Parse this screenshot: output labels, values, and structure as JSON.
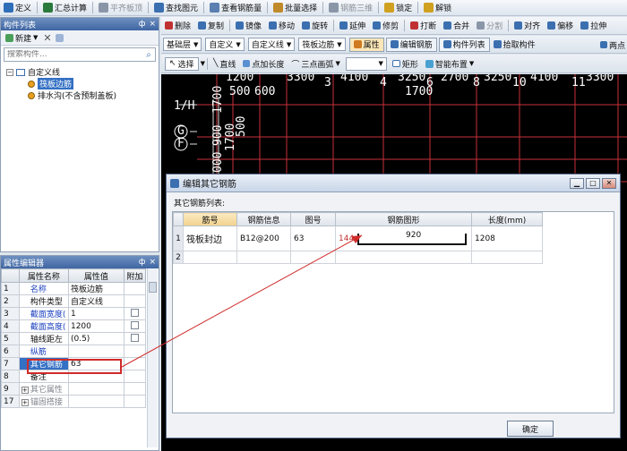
{
  "menubar": {
    "items": [
      {
        "label": "定义",
        "color": "#2f6fb8",
        "enabled": true
      },
      {
        "label": "汇总计算",
        "color": "#2b7a3d",
        "enabled": true
      },
      {
        "label": "平齐板顶",
        "color": "#8a96a8",
        "enabled": false
      },
      {
        "label": "查找图元",
        "color": "#3b6fb0",
        "enabled": true
      },
      {
        "label": "查看钢筋量",
        "color": "#5a7fb0",
        "enabled": true
      },
      {
        "label": "批量选择",
        "color": "#c08a2a",
        "enabled": true
      },
      {
        "label": "钢筋三维",
        "color": "#8a96a8",
        "enabled": false
      },
      {
        "label": "锁定",
        "color": "#d0a020",
        "enabled": true
      },
      {
        "label": "解锁",
        "color": "#d0a020",
        "enabled": true
      }
    ]
  },
  "toolbar1": {
    "items": [
      {
        "label": "删除",
        "color": "#c03030",
        "enabled": true
      },
      {
        "label": "复制",
        "color": "#3b6fb0",
        "enabled": true
      },
      {
        "label": "镜像",
        "color": "#3b6fb0",
        "enabled": true
      },
      {
        "label": "移动",
        "color": "#3b6fb0",
        "enabled": true
      },
      {
        "label": "旋转",
        "color": "#3b6fb0",
        "enabled": true
      },
      {
        "label": "延伸",
        "color": "#3b6fb0",
        "enabled": true
      },
      {
        "label": "修剪",
        "color": "#3b6fb0",
        "enabled": true
      },
      {
        "label": "打断",
        "color": "#c03030",
        "enabled": true
      },
      {
        "label": "合并",
        "color": "#3b6fb0",
        "enabled": true
      },
      {
        "label": "分割",
        "color": "#8a96a8",
        "enabled": false
      },
      {
        "label": "对齐",
        "color": "#3b6fb0",
        "enabled": true
      },
      {
        "label": "偏移",
        "color": "#3b6fb0",
        "enabled": true
      },
      {
        "label": "拉伸",
        "color": "#3b6fb0",
        "enabled": true
      }
    ]
  },
  "toolbar2": {
    "floor": "基础层",
    "category": "自定义",
    "type": "自定义线",
    "component": "筏板边筋",
    "buttons": [
      {
        "label": "属性",
        "color": "#d07a20"
      },
      {
        "label": "编辑钢筋",
        "color": "#3b6fb0"
      },
      {
        "label": "构件列表",
        "color": "#3b6fb0"
      },
      {
        "label": "拾取构件",
        "color": "#3b6fb0"
      }
    ],
    "two_point": "两点"
  },
  "toolbar3": {
    "select": "选择",
    "line": "直线",
    "point_length": "点加长度",
    "arc": "三点画弧",
    "rect": "矩形",
    "smart": "智能布置"
  },
  "component_list": {
    "title": "构件列表",
    "pin": "ф",
    "close": "×",
    "new_button": "新建",
    "search_placeholder": "搜索构件...",
    "tree": {
      "root": "自定义线",
      "children": [
        {
          "label": "筏板边筋",
          "selected": true
        },
        {
          "label": "排水沟(不含预制盖板)",
          "selected": false
        }
      ]
    }
  },
  "property_editor": {
    "title": "属性编辑器",
    "headers": [
      "属性名称",
      "属性值",
      "附加"
    ],
    "rows": [
      {
        "num": "1",
        "name": "名称",
        "value": "筏板边筋",
        "checkbox": false,
        "style": "blue"
      },
      {
        "num": "2",
        "name": "构件类型",
        "value": "自定义线",
        "checkbox": false,
        "style": "normal"
      },
      {
        "num": "3",
        "name": "截面宽度(",
        "value": "1",
        "checkbox": true,
        "style": "blue"
      },
      {
        "num": "4",
        "name": "截面高度(",
        "value": "1200",
        "checkbox": true,
        "style": "blue"
      },
      {
        "num": "5",
        "name": "轴线距左",
        "value": "(0.5)",
        "checkbox": true,
        "style": "normal"
      },
      {
        "num": "6",
        "name": "纵筋",
        "value": "",
        "checkbox": false,
        "style": "blue"
      },
      {
        "num": "7",
        "name": "其它钢筋",
        "value": "63",
        "checkbox": false,
        "style": "selected"
      },
      {
        "num": "8",
        "name": "备注",
        "value": "",
        "checkbox": false,
        "style": "normal"
      },
      {
        "num": "9",
        "name": "其它属性",
        "value": "",
        "checkbox": false,
        "style": "group"
      },
      {
        "num": "17",
        "name": "锚固搭接",
        "value": "",
        "checkbox": false,
        "style": "group"
      }
    ]
  },
  "canvas": {
    "top_dims": [
      "1200",
      "3300",
      "4100",
      "3250",
      "2700",
      "3250",
      "4100",
      "3300"
    ],
    "top_nums": [
      "3",
      "4",
      "6",
      "8",
      "10",
      "11"
    ],
    "sub_dims": [
      "500",
      "600",
      "1700"
    ],
    "axis_labels": [
      "1/H",
      "G",
      "F"
    ],
    "vertical_dims": [
      "1700",
      "500",
      "900",
      "1700",
      "000"
    ]
  },
  "dialog": {
    "title": "编辑其它钢筋",
    "section_label": "其它钢筋列表:",
    "headers": [
      "筋号",
      "钢筋信息",
      "图号",
      "钢筋图形",
      "长度(mm)"
    ],
    "rows": [
      {
        "num": "1",
        "bar_no": "筏板封边",
        "info": "B12@200",
        "shape_no": "63",
        "shape_left": "144",
        "shape_mid": "920",
        "length": "1208"
      },
      {
        "num": "2",
        "bar_no": "",
        "info": "",
        "shape_no": "",
        "shape_left": "",
        "shape_mid": "",
        "length": ""
      }
    ],
    "ok_button": "确定"
  }
}
